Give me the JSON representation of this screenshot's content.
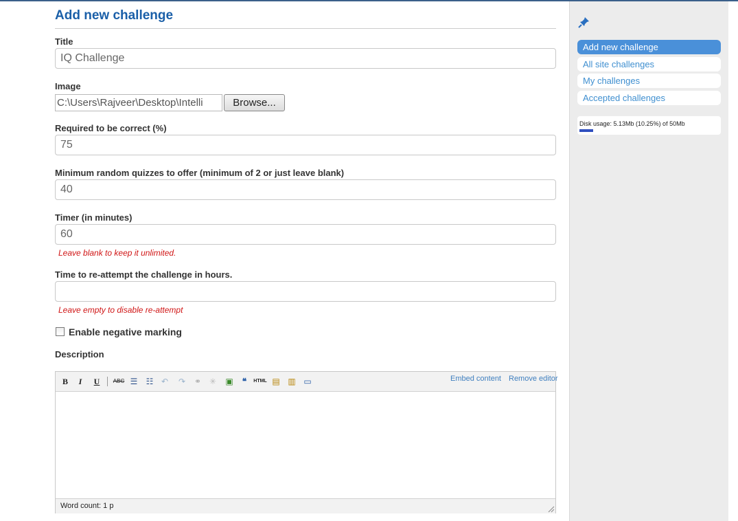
{
  "form": {
    "heading": "Add new challenge",
    "title_label": "Title",
    "title_value": "IQ Challenge",
    "image_label": "Image",
    "image_path": "C:\\Users\\Rajveer\\Desktop\\Intelli",
    "browse_label": "Browse...",
    "correct_label": "Required to be correct (%)",
    "correct_value": "75",
    "min_quizzes_label": "Minimum random quizzes to offer (minimum of 2 or just leave blank)",
    "min_quizzes_value": "40",
    "timer_label": "Timer (in minutes)",
    "timer_value": "60",
    "timer_hint": "Leave blank to keep it unlimited.",
    "reattempt_label": "Time to re-attempt the challenge in hours.",
    "reattempt_value": "",
    "reattempt_hint": "Leave empty to disable re-attempt",
    "negative_label": "Enable negative marking",
    "negative_checked": false,
    "description_label": "Description"
  },
  "editor": {
    "toolbar": [
      {
        "name": "bold-icon",
        "glyph": "B"
      },
      {
        "name": "italic-icon",
        "glyph": "I"
      },
      {
        "name": "underline-icon",
        "glyph": "U"
      },
      {
        "name": "spellcheck-icon",
        "glyph": "ABC"
      },
      {
        "name": "bullet-list-icon",
        "glyph": "☰"
      },
      {
        "name": "numbered-list-icon",
        "glyph": "☷"
      },
      {
        "name": "undo-icon",
        "glyph": "↶"
      },
      {
        "name": "redo-icon",
        "glyph": "↷"
      },
      {
        "name": "link-icon",
        "glyph": "⚭"
      },
      {
        "name": "unlink-icon",
        "glyph": "✳"
      },
      {
        "name": "image-icon",
        "glyph": "▣"
      },
      {
        "name": "quote-icon",
        "glyph": "❝"
      },
      {
        "name": "html-icon",
        "glyph": "HTML"
      },
      {
        "name": "paste-text-icon",
        "glyph": "▤"
      },
      {
        "name": "paste-word-icon",
        "glyph": "▥"
      },
      {
        "name": "fullscreen-icon",
        "glyph": "▭"
      }
    ],
    "embed_label": "Embed content",
    "remove_label": "Remove editor",
    "word_count": "Word count: 1 p"
  },
  "sidebar": {
    "pin_icon": "pin-icon",
    "items": [
      {
        "label": "Add new challenge",
        "active": true
      },
      {
        "label": "All site challenges",
        "active": false
      },
      {
        "label": "My challenges",
        "active": false
      },
      {
        "label": "Accepted challenges",
        "active": false
      }
    ],
    "disk_usage_text": "Disk usage: 5.13Mb (10.25%) of 50Mb",
    "disk_usage_fraction": 0.1025
  },
  "colors": {
    "heading": "#1a5fa8",
    "hint": "#d01515",
    "nav_active": "#4a90d9",
    "nav_link": "#3f8fd0",
    "disk_bar": "#2f4fbf"
  }
}
